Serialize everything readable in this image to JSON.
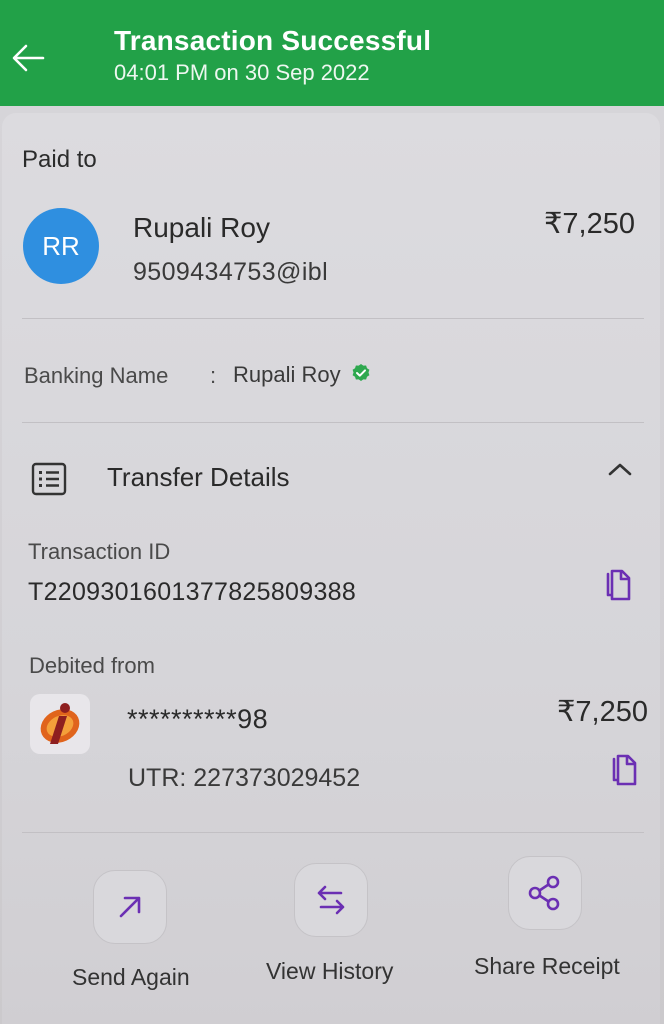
{
  "header": {
    "title": "Transaction Successful",
    "subtitle": "04:01 PM on 30 Sep 2022",
    "bg_color": "#22a148"
  },
  "payee": {
    "section_label": "Paid to",
    "initials": "RR",
    "name": "Rupali Roy",
    "upi_id": "9509434753@ibl",
    "amount": "₹7,250",
    "avatar_color": "#2f8fe0"
  },
  "banking": {
    "label": "Banking Name",
    "separator": ":",
    "value": "Rupali Roy",
    "verified_icon": "verified-check-icon"
  },
  "transfer_details": {
    "title": "Transfer Details",
    "icon": "list-icon",
    "expanded": true,
    "transaction_id_label": "Transaction ID",
    "transaction_id": "T2209301601377825809388",
    "debited_from_label": "Debited from",
    "masked_account": "**********98",
    "debit_amount": "₹7,250",
    "utr": "UTR: 227373029452",
    "accent_color": "#6b2fb3"
  },
  "actions": [
    {
      "label": "Send Again",
      "icon": "arrow-up-right-icon"
    },
    {
      "label": "View History",
      "icon": "swap-arrows-icon"
    },
    {
      "label": "Share Receipt",
      "icon": "share-icon"
    }
  ]
}
